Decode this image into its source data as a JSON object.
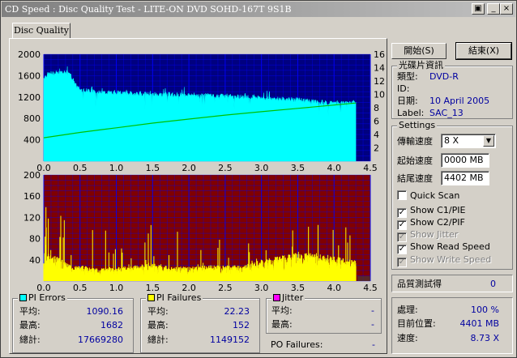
{
  "window": {
    "title": "CD Speed : Disc Quality Test - LITE-ON DVD SOHD-167T    9S1B",
    "buttons": {
      "help": "▣",
      "minimize": "_",
      "maximize": "□",
      "close": "×"
    }
  },
  "tabs": [
    {
      "label": "Disc Quality"
    }
  ],
  "actions": {
    "start_label": "開始(S)",
    "end_label": "結束(X)"
  },
  "disc_info": {
    "title": "光碟片資訊",
    "type_label": "類型:",
    "type_value": "DVD-R",
    "id_label": "ID:",
    "id_value": "",
    "date_label": "日期:",
    "date_value": "10 April 2005",
    "label_label": "Label:",
    "label_value": "SAC_13"
  },
  "settings": {
    "title": "Settings",
    "speed_label": "傳輸速度",
    "speed_value": "8 X",
    "start_label": "起始速度",
    "start_value": "0000 MB",
    "end_label": "結尾速度",
    "end_value": "4402 MB",
    "checkboxes": [
      {
        "label": "Quick Scan",
        "checked": false,
        "enabled": true
      },
      {
        "label": "Show C1/PIE",
        "checked": true,
        "enabled": true
      },
      {
        "label": "Show C2/PIF",
        "checked": true,
        "enabled": true
      },
      {
        "label": "Show Jitter",
        "checked": true,
        "enabled": false
      },
      {
        "label": "Show Read Speed",
        "checked": true,
        "enabled": true
      },
      {
        "label": "Show Write Speed",
        "checked": true,
        "enabled": false
      }
    ]
  },
  "quality": {
    "label": "品質測試得",
    "value": "0"
  },
  "progress": {
    "process_label": "處理:",
    "process_value": "100 %",
    "position_label": "目前位置:",
    "position_value": "4401 MB",
    "speed_label": "速度:",
    "speed_value": "8.73 X"
  },
  "stats": {
    "pi_errors": {
      "title": "PI Errors",
      "avg_label": "平均:",
      "avg": "1090.16",
      "max_label": "最高:",
      "max": "1682",
      "total_label": "總計:",
      "total": "17669280"
    },
    "pi_failures": {
      "title": "PI Failures",
      "avg_label": "平均:",
      "avg": "22.23",
      "max_label": "最高:",
      "max": "152",
      "total_label": "總計:",
      "total": "1149152"
    },
    "jitter": {
      "title": "Jitter",
      "avg_label": "平均:",
      "avg": "-",
      "max_label": "最高:",
      "max": "-"
    },
    "po_failures": {
      "label": "PO Failures:",
      "value": "-"
    }
  },
  "colors": {
    "pie_fill": "#00ffff",
    "pif_fill": "#ffff00",
    "read_speed": "#00c000",
    "top_bg": "#000080",
    "bottom_bg": "#800000",
    "grid": "#0000ff",
    "pi_swatch": "#00ffff",
    "pif_swatch": "#ffff00",
    "jitter_swatch": "#ff00ff"
  },
  "chart_data": [
    {
      "type": "area",
      "name": "PI Errors / Read Speed",
      "x_ticks": [
        "0.0",
        "0.5",
        "1.0",
        "1.5",
        "2.0",
        "2.5",
        "3.0",
        "3.5",
        "4.0",
        "4.5"
      ],
      "xlim": [
        0,
        4.5
      ],
      "ylim": [
        0,
        2000
      ],
      "y_ticks": [
        "2000",
        "1600",
        "1200",
        "800",
        "400"
      ],
      "y2lim": [
        0,
        16
      ],
      "y2_ticks": [
        "16",
        "14",
        "12",
        "10",
        "8",
        "6",
        "4",
        "2"
      ],
      "series": [
        {
          "name": "PI Errors",
          "x": [
            0,
            0.05,
            0.1,
            0.2,
            0.3,
            0.35,
            0.45,
            0.5,
            0.75,
            1.0,
            1.25,
            1.5,
            1.75,
            2.0,
            2.25,
            2.5,
            2.75,
            3.0,
            3.25,
            3.5,
            3.75,
            4.0,
            4.2,
            4.3
          ],
          "y": [
            1560,
            1620,
            1640,
            1640,
            1650,
            1660,
            1400,
            1340,
            1290,
            1280,
            1260,
            1250,
            1250,
            1240,
            1230,
            1220,
            1200,
            1180,
            1160,
            1150,
            1110,
            1090,
            1100,
            1100
          ]
        },
        {
          "name": "Read Speed",
          "x": [
            0,
            0.5,
            1.0,
            1.5,
            2.0,
            2.5,
            3.0,
            3.5,
            4.0,
            4.3
          ],
          "y": [
            3.5,
            4.3,
            5.0,
            5.7,
            6.3,
            6.9,
            7.4,
            7.9,
            8.4,
            8.7
          ]
        }
      ]
    },
    {
      "type": "bar",
      "name": "PI Failures",
      "x_ticks": [
        "0.0",
        "0.5",
        "1.0",
        "1.5",
        "2.0",
        "2.5",
        "3.0",
        "3.5",
        "4.0",
        "4.5"
      ],
      "xlim": [
        0,
        4.5
      ],
      "ylim": [
        0,
        200
      ],
      "y_ticks": [
        "200",
        "160",
        "120",
        "80",
        "40"
      ],
      "series": [
        {
          "name": "PI Failures",
          "x": [
            0,
            0.1,
            0.25,
            0.4,
            0.5,
            0.75,
            1.0,
            1.25,
            1.5,
            1.75,
            2.0,
            2.25,
            2.5,
            2.75,
            3.0,
            3.25,
            3.5,
            3.75,
            4.0,
            4.2,
            4.3
          ],
          "y": [
            30,
            45,
            30,
            20,
            22,
            18,
            20,
            22,
            25,
            20,
            20,
            22,
            22,
            22,
            30,
            35,
            40,
            40,
            35,
            30,
            30
          ]
        }
      ]
    }
  ]
}
